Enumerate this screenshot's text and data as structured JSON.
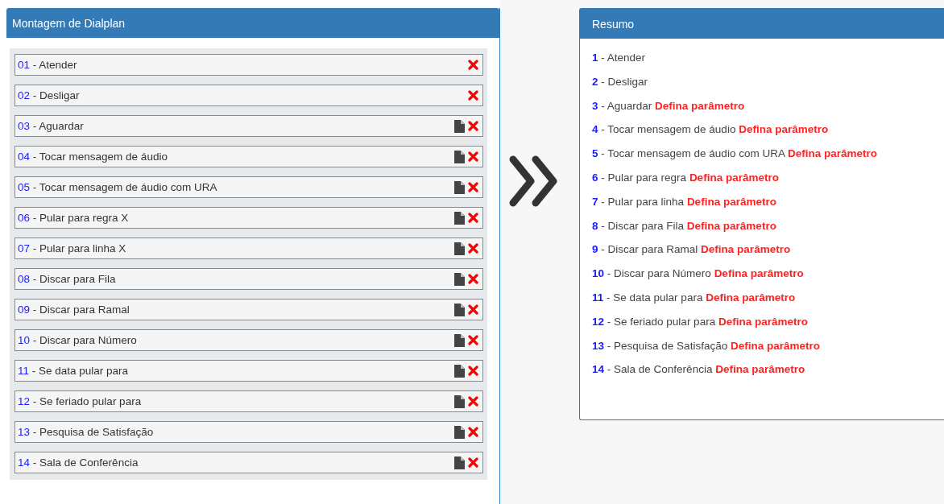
{
  "builder": {
    "title": "Montagem de Dialplan",
    "steps": [
      {
        "number": "01",
        "separator": "-",
        "label": "Atender",
        "has_params": false
      },
      {
        "number": "02",
        "separator": "-",
        "label": "Desligar",
        "has_params": false
      },
      {
        "number": "03",
        "separator": "-",
        "label": "Aguardar",
        "has_params": true
      },
      {
        "number": "04",
        "separator": "-",
        "label": "Tocar mensagem de áudio",
        "has_params": true
      },
      {
        "number": "05",
        "separator": "-",
        "label": "Tocar mensagem de áudio com URA",
        "has_params": true
      },
      {
        "number": "06",
        "separator": "-",
        "label": "Pular para regra X",
        "has_params": true
      },
      {
        "number": "07",
        "separator": "-",
        "label": "Pular para linha X",
        "has_params": true
      },
      {
        "number": "08",
        "separator": "-",
        "label": "Discar para Fila",
        "has_params": true
      },
      {
        "number": "09",
        "separator": "-",
        "label": "Discar para Ramal",
        "has_params": true
      },
      {
        "number": "10",
        "separator": "-",
        "label": "Discar para Número",
        "has_params": true
      },
      {
        "number": "11",
        "separator": "-",
        "label": "Se data pular para",
        "has_params": true
      },
      {
        "number": "12",
        "separator": "-",
        "label": "Se feriado pular para",
        "has_params": true
      },
      {
        "number": "13",
        "separator": "-",
        "label": "Pesquisa de Satisfação",
        "has_params": true
      },
      {
        "number": "14",
        "separator": "-",
        "label": "Sala de Conferência",
        "has_params": true
      }
    ]
  },
  "summary": {
    "title": "Resumo",
    "items": [
      {
        "number": "1",
        "separator": "-",
        "label": "Atender"
      },
      {
        "number": "2",
        "separator": "-",
        "label": "Desligar"
      },
      {
        "number": "3",
        "separator": "-",
        "label": "Aguardar",
        "warning": "Defina parâmetro"
      },
      {
        "number": "4",
        "separator": "-",
        "label": "Tocar mensagem de áudio",
        "warning": "Defina parâmetro"
      },
      {
        "number": "5",
        "separator": "-",
        "label": "Tocar mensagem de áudio com URA",
        "warning": "Defina parâmetro"
      },
      {
        "number": "6",
        "separator": "-",
        "label": "Pular para regra",
        "warning": "Defina parâmetro"
      },
      {
        "number": "7",
        "separator": "-",
        "label": "Pular para linha",
        "warning": "Defina parâmetro"
      },
      {
        "number": "8",
        "separator": "-",
        "label": "Discar para Fila",
        "warning": "Defina parâmetro"
      },
      {
        "number": "9",
        "separator": "-",
        "label": "Discar para Ramal",
        "warning": "Defina parâmetro"
      },
      {
        "number": "10",
        "separator": "-",
        "label": "Discar para Número",
        "warning": "Defina parâmetro"
      },
      {
        "number": "11",
        "separator": "-",
        "label": "Se data pular para",
        "warning": "Defina parâmetro"
      },
      {
        "number": "12",
        "separator": "-",
        "label": "Se feriado pular para",
        "warning": "Defina parâmetro"
      },
      {
        "number": "13",
        "separator": "-",
        "label": "Pesquisa de Satisfação",
        "warning": "Defina parâmetro"
      },
      {
        "number": "14",
        "separator": "-",
        "label": "Sala de Conferência",
        "warning": "Defina parâmetro"
      }
    ]
  }
}
